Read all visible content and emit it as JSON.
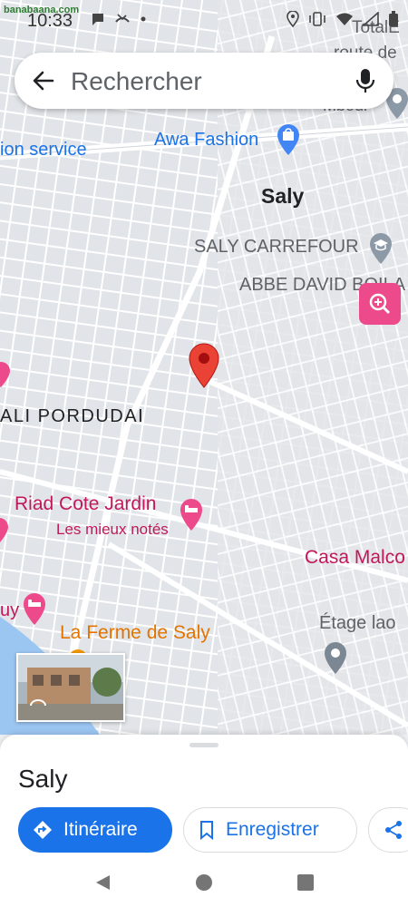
{
  "status_bar": {
    "time": "10:33",
    "watermark": "banabaana.com",
    "watermark_sub": ""
  },
  "search": {
    "placeholder": "Rechercher"
  },
  "map": {
    "labels": {
      "total": "TotalE",
      "route": "route de",
      "mbour": "Mbour",
      "ion_service": "ion service",
      "awa_fashion": "Awa Fashion",
      "saly": "Saly",
      "saly_carrefour": "SALY CARREFOUR",
      "abbe_david": "ABBE DAVID BOILA",
      "ali_pordudai": "ALI PORDUDAI",
      "riad": "Riad Cote Jardin",
      "riad_sub": "Les mieux notés",
      "casa": "Casa Malco",
      "uy": "uy",
      "ferme": "La Ferme de Saly",
      "etage": "Étage lao"
    },
    "colors": {
      "pin": "#ea4335",
      "water": "#9cc6f2",
      "road": "#ffffff",
      "block": "#e3e5e8"
    }
  },
  "sheet": {
    "title": "Saly",
    "itineraire": "Itinéraire",
    "enregistrer": "Enregistrer"
  }
}
